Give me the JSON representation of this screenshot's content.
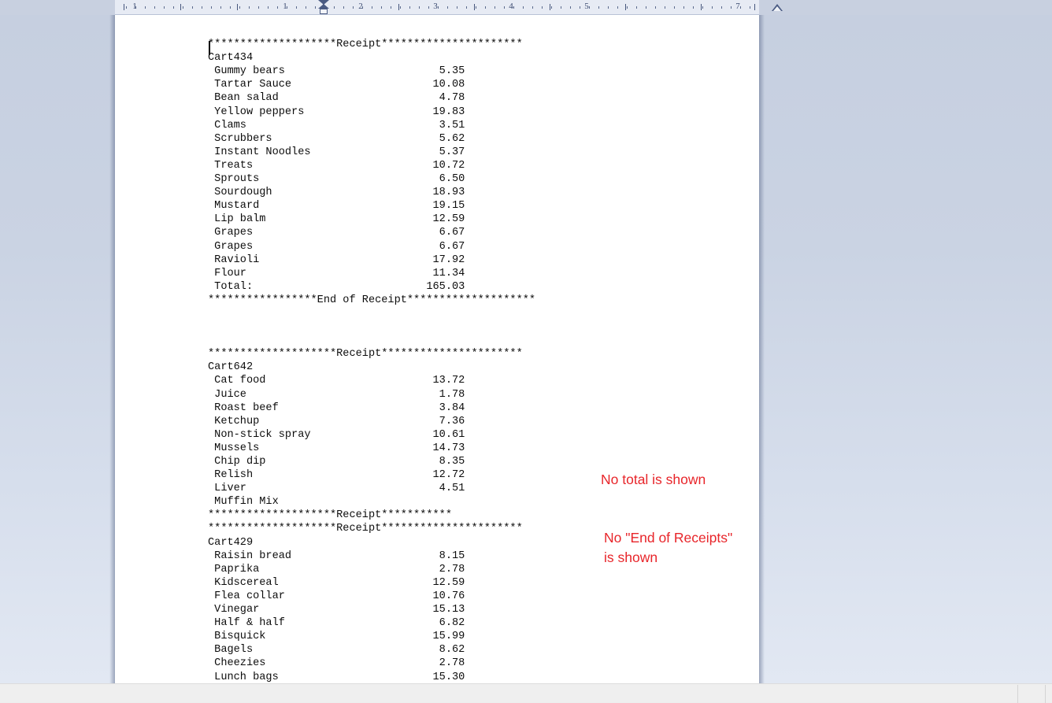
{
  "window": {
    "background_color": "#c8d0e0",
    "page_color": "#ffffff",
    "annotation_color": "#e8252a"
  },
  "ruler": {
    "name": "horizontal-ruler",
    "unit": "inches",
    "numbers": [
      "1",
      "1",
      "2",
      "3",
      "4",
      "5",
      "7"
    ],
    "left_indent_marker": "first-line-indent-marker",
    "right_indent_marker": "right-indent-marker"
  },
  "document": {
    "caret_visible": true,
    "text": "\n********************Receipt**********************\nCart434\n Gummy bears                        5.35\n Tartar Sauce                      10.08\n Bean salad                         4.78\n Yellow peppers                    19.83\n Clams                              3.51\n Scrubbers                          5.62\n Instant Noodles                    5.37\n Treats                            10.72\n Sprouts                            6.50\n Sourdough                         18.93\n Mustard                           19.15\n Lip balm                          12.59\n Grapes                             6.67\n Grapes                             6.67\n Ravioli                           17.92\n Flour                             11.34\n Total:                           165.03\n*****************End of Receipt********************\n\n\n\n********************Receipt**********************\nCart642\n Cat food                          13.72\n Juice                              1.78\n Roast beef                         3.84\n Ketchup                            7.36\n Non-stick spray                   10.61\n Mussels                           14.73\n Chip dip                           8.35\n Relish                            12.72\n Liver                              4.51\n Muffin Mix\n********************Receipt***********\n********************Receipt**********************\nCart429\n Raisin bread                       8.15\n Paprika                            2.78\n Kidscereal                        12.59\n Flea collar                       10.76\n Vinegar                           15.13\n Half & half                        6.82\n Bisquick                          15.99\n Bagels                             8.62\n Cheezies                           2.78\n Lunch bags                        15.30",
    "receipts": [
      {
        "header": "********************Receipt**********************",
        "cart_id": "Cart434",
        "items": [
          {
            "name": "Gummy bears",
            "price": "5.35"
          },
          {
            "name": "Tartar Sauce",
            "price": "10.08"
          },
          {
            "name": "Bean salad",
            "price": "4.78"
          },
          {
            "name": "Yellow peppers",
            "price": "19.83"
          },
          {
            "name": "Clams",
            "price": "3.51"
          },
          {
            "name": "Scrubbers",
            "price": "5.62"
          },
          {
            "name": "Instant Noodles",
            "price": "5.37"
          },
          {
            "name": "Treats",
            "price": "10.72"
          },
          {
            "name": "Sprouts",
            "price": "6.50"
          },
          {
            "name": "Sourdough",
            "price": "18.93"
          },
          {
            "name": "Mustard",
            "price": "19.15"
          },
          {
            "name": "Lip balm",
            "price": "12.59"
          },
          {
            "name": "Grapes",
            "price": "6.67"
          },
          {
            "name": "Grapes",
            "price": "6.67"
          },
          {
            "name": "Ravioli",
            "price": "17.92"
          },
          {
            "name": "Flour",
            "price": "11.34"
          }
        ],
        "total_label": "Total:",
        "total": "165.03",
        "footer": "*****************End of Receipt********************"
      },
      {
        "header": "********************Receipt**********************",
        "cart_id": "Cart642",
        "items": [
          {
            "name": "Cat food",
            "price": "13.72"
          },
          {
            "name": "Juice",
            "price": "1.78"
          },
          {
            "name": "Roast beef",
            "price": "3.84"
          },
          {
            "name": "Ketchup",
            "price": "7.36"
          },
          {
            "name": "Non-stick spray",
            "price": "10.61"
          },
          {
            "name": "Mussels",
            "price": "14.73"
          },
          {
            "name": "Chip dip",
            "price": "8.35"
          },
          {
            "name": "Relish",
            "price": "12.72"
          },
          {
            "name": "Liver",
            "price": "4.51"
          },
          {
            "name": "Muffin Mix",
            "price": ""
          }
        ],
        "total_label": "",
        "total": "",
        "footer": "********************Receipt***********"
      },
      {
        "header": "********************Receipt**********************",
        "cart_id": "Cart429",
        "items": [
          {
            "name": "Raisin bread",
            "price": "8.15"
          },
          {
            "name": "Paprika",
            "price": "2.78"
          },
          {
            "name": "Kidscereal",
            "price": "12.59"
          },
          {
            "name": "Flea collar",
            "price": "10.76"
          },
          {
            "name": "Vinegar",
            "price": "15.13"
          },
          {
            "name": "Half & half",
            "price": "6.82"
          },
          {
            "name": "Bisquick",
            "price": "15.99"
          },
          {
            "name": "Bagels",
            "price": "8.62"
          },
          {
            "name": "Cheezies",
            "price": "2.78"
          },
          {
            "name": "Lunch bags",
            "price": "15.30"
          }
        ],
        "total_label": "",
        "total": "",
        "footer": ""
      }
    ]
  },
  "annotations": [
    {
      "id": "no-total-note",
      "text": "No total is shown"
    },
    {
      "id": "no-end-of-receipts-note",
      "text": "No \"End of Receipts\"\nis shown"
    }
  ],
  "statusbar": {
    "text": ""
  }
}
